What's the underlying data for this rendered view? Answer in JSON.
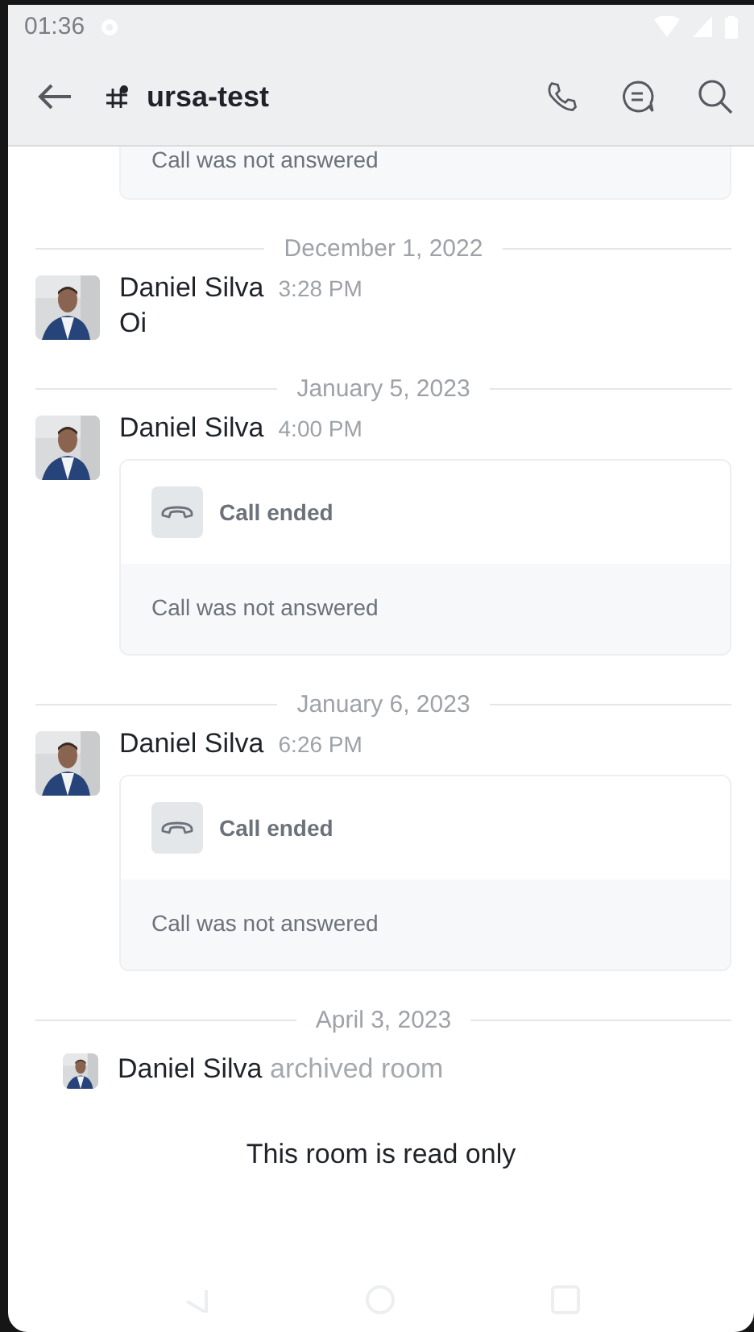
{
  "status_bar": {
    "time": "01:36"
  },
  "header": {
    "title": "ursa-test"
  },
  "timeline": [
    {
      "kind": "call_tail",
      "note": "Call was not answered"
    },
    {
      "kind": "date",
      "label": "December 1, 2022"
    },
    {
      "kind": "message",
      "author": "Daniel Silva",
      "time": "3:28 PM",
      "text": "Oi"
    },
    {
      "kind": "date",
      "label": "January 5, 2023"
    },
    {
      "kind": "call",
      "author": "Daniel Silva",
      "time": "4:00 PM",
      "status": "Call ended",
      "note": "Call was not answered"
    },
    {
      "kind": "date",
      "label": "January 6, 2023"
    },
    {
      "kind": "call",
      "author": "Daniel Silva",
      "time": "6:26 PM",
      "status": "Call ended",
      "note": "Call was not answered"
    },
    {
      "kind": "date",
      "label": "April 3, 2023"
    },
    {
      "kind": "system",
      "author": "Daniel Silva",
      "action": "archived room"
    }
  ],
  "footer": {
    "notice": "This room is read only"
  }
}
